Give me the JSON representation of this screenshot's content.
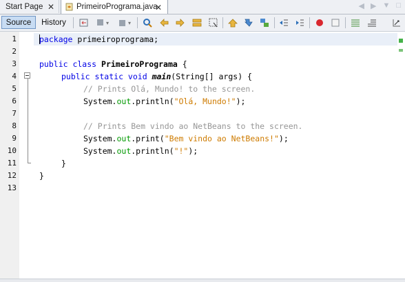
{
  "tabs": [
    {
      "label": "Start Page",
      "close": "✕"
    },
    {
      "label": "PrimeiroPrograma.java",
      "close": "✕"
    }
  ],
  "toolbar": {
    "source_label": "Source",
    "history_label": "History",
    "icons": [
      "last-edit-icon",
      "back-icon",
      "forward-icon",
      "find-icon",
      "find-prev-icon",
      "find-next-icon",
      "find-selection-icon",
      "toggle-highlight-icon",
      "prev-bookmark-icon",
      "next-bookmark-icon",
      "toggle-bookmark-icon",
      "shift-left-icon",
      "shift-right-icon",
      "record-macro-icon",
      "stop-macro-icon",
      "comment-icon",
      "uncomment-icon"
    ]
  },
  "editor": {
    "line_numbers": [
      "1",
      "2",
      "3",
      "4",
      "5",
      "6",
      "7",
      "8",
      "9",
      "10",
      "11",
      "12",
      "13"
    ],
    "lines": {
      "l1_kw": "package",
      "l1_rest": " primeiroprograma;",
      "l3_kw": "public class",
      "l3_name": "PrimeiroPrograma",
      "l3_rest": " {",
      "l4_kw": "public static void",
      "l4_name": "main",
      "l4_rest": "(String[] args) {",
      "l5_comment": "// Prints Olá, Mundo! to the screen.",
      "l6_obj": "System.",
      "l6_field": "out",
      "l6_call": ".println(",
      "l6_str": "\"Olá, Mundo!\"",
      "l6_end": ");",
      "l8_comment": "// Prints Bem vindo ao NetBeans to the screen.",
      "l9_obj": "System.",
      "l9_field": "out",
      "l9_call": ".print(",
      "l9_str": "\"Bem vindo ao NetBeans!\"",
      "l9_end": ");",
      "l10_obj": "System.",
      "l10_field": "out",
      "l10_call": ".println(",
      "l10_str": "\"!\"",
      "l10_end": ");",
      "l11": "}",
      "l12": "}"
    }
  },
  "colors": {
    "keyword": "#0000e6",
    "comment": "#969696",
    "string": "#ce7b00",
    "field": "#009900",
    "current_line": "#e9eff8"
  }
}
